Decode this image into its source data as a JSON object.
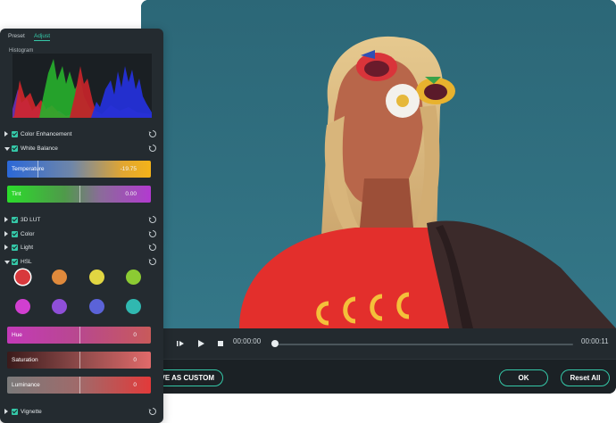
{
  "panel": {
    "tabs": [
      {
        "label": "Preset"
      },
      {
        "label": "Adjust"
      }
    ],
    "histogram_label": "Histogram",
    "sections": {
      "color_enhancement": "Color Enhancement",
      "white_balance": "White Balance",
      "lut_3d": "3D LUT",
      "color": "Color",
      "light": "Light",
      "hsl": "HSL",
      "vignette": "Vignette"
    },
    "temperature": {
      "label": "Temperature",
      "value": "-19.75",
      "level": 0.21
    },
    "tint": {
      "label": "Tint",
      "value": "0.00",
      "level": 0.5
    },
    "hue": {
      "label": "Hue",
      "value": "0",
      "level": 0.5
    },
    "saturation": {
      "label": "Saturation",
      "value": "0",
      "level": 0.5
    },
    "luminance": {
      "label": "Luminance",
      "value": "0",
      "level": 0.5
    },
    "hsl_colors": [
      "#d8393d",
      "#e08a3c",
      "#e1d642",
      "#8ccb33",
      "#d13fd0",
      "#8f4fd8",
      "#5b63d8",
      "#30b8b0"
    ],
    "selected_hsl_color": 0
  },
  "player": {
    "current_time": "00:00:00",
    "total_time": "00:00:11",
    "progress": 0
  },
  "actions": {
    "save_custom": "AVE AS CUSTOM",
    "ok": "OK",
    "reset_all": "Reset All"
  },
  "colors": {
    "accent": "#35c8a8",
    "panel_bg": "#242b30",
    "sky": "#2f6d7d",
    "shirt": "#e32f2c"
  }
}
